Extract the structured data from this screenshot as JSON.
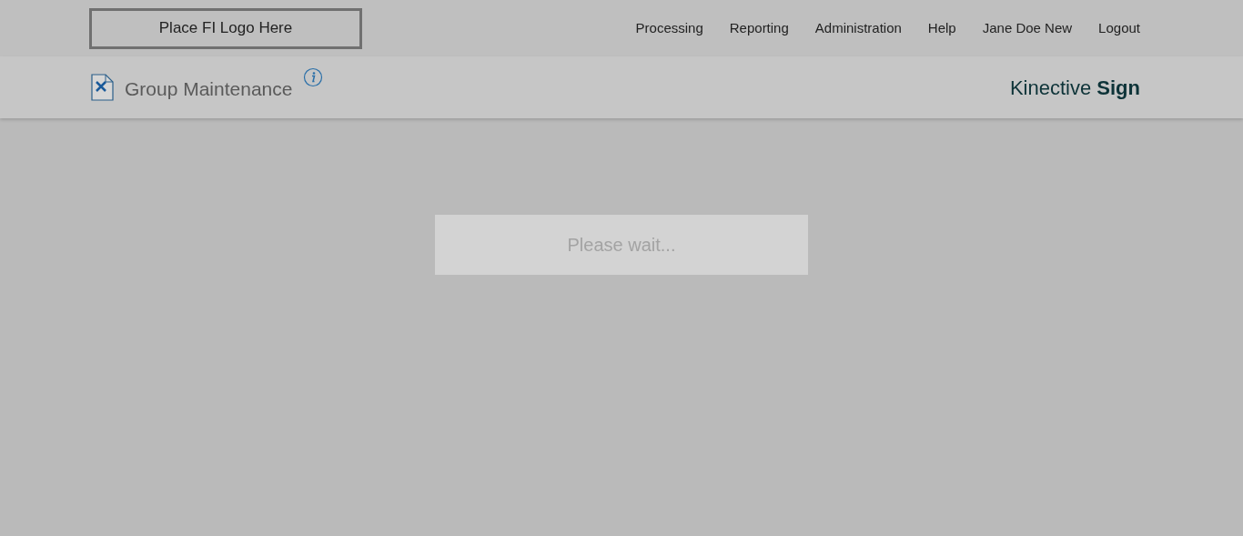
{
  "logo_placeholder": "Place FI Logo Here",
  "nav": [
    "Processing",
    "Reporting",
    "Administration",
    "Help",
    "Jane Doe New",
    "Logout"
  ],
  "page_title": "Group Maintenance",
  "brand": "Kinective **Sign**",
  "loading_message": "Please wait..."
}
